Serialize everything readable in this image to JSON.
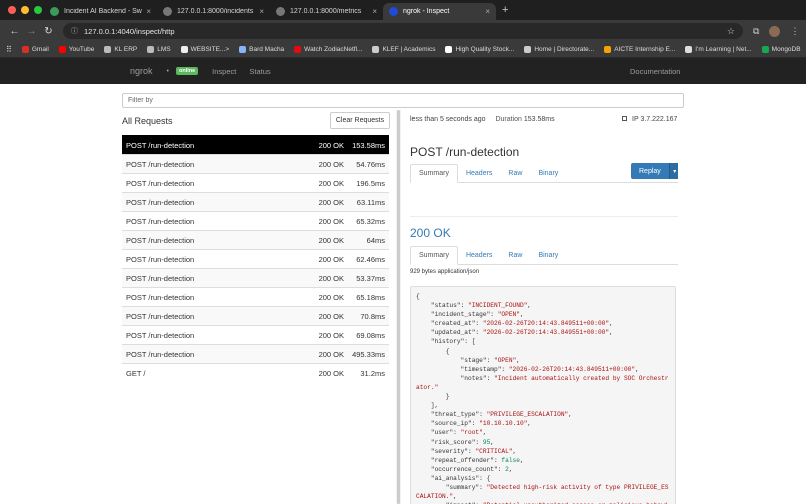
{
  "browser": {
    "tabs": [
      {
        "title": "Incident AI Backend - Swagg",
        "icon_color": "#3c9a5c",
        "active": false
      },
      {
        "title": "127.0.0.1:8000/incidents",
        "icon_color": "#777777",
        "active": false
      },
      {
        "title": "127.0.0.1:8000/metrics",
        "icon_color": "#777777",
        "active": false
      },
      {
        "title": "ngrok - Inspect",
        "icon_color": "#1f4bd8",
        "active": true
      }
    ],
    "url": "127.0.0.1:4040/inspect/http",
    "bookmarks": [
      {
        "label": "Gmail",
        "color": "#d93025"
      },
      {
        "label": "YouTube",
        "color": "#ff0000"
      },
      {
        "label": "KL ERP",
        "color": "#bbbbbb"
      },
      {
        "label": "LMS",
        "color": "#bbbbbb"
      },
      {
        "label": "WEBSITE...>",
        "color": "#eeeeee"
      },
      {
        "label": "Bard Macha",
        "color": "#8ab4f8"
      },
      {
        "label": "Watch ZodiacNetfl...",
        "color": "#e50914"
      },
      {
        "label": "KLEF | Academics",
        "color": "#cccccc"
      },
      {
        "label": "High Quality Stock...",
        "color": "#ffffff"
      },
      {
        "label": "Home | Directorate...",
        "color": "#cccccc"
      },
      {
        "label": "AICTE Internship E...",
        "color": "#f4a300"
      },
      {
        "label": "I'm Learning | Net...",
        "color": "#dddddd"
      },
      {
        "label": "MongoDB",
        "color": "#13aa52"
      }
    ]
  },
  "ngrok": {
    "brand": "ngrok",
    "badge": "online",
    "nav_inspect": "Inspect",
    "nav_status": "Status",
    "documentation": "Documentation"
  },
  "filter": {
    "placeholder": "Filter by"
  },
  "requests": {
    "title": "All Requests",
    "clear_label": "Clear Requests",
    "rows": [
      {
        "path": "POST /run-detection",
        "status": "200 OK",
        "duration": "153.58ms"
      },
      {
        "path": "POST /run-detection",
        "status": "200 OK",
        "duration": "54.76ms"
      },
      {
        "path": "POST /run-detection",
        "status": "200 OK",
        "duration": "196.5ms"
      },
      {
        "path": "POST /run-detection",
        "status": "200 OK",
        "duration": "63.11ms"
      },
      {
        "path": "POST /run-detection",
        "status": "200 OK",
        "duration": "65.32ms"
      },
      {
        "path": "POST /run-detection",
        "status": "200 OK",
        "duration": "64ms"
      },
      {
        "path": "POST /run-detection",
        "status": "200 OK",
        "duration": "62.46ms"
      },
      {
        "path": "POST /run-detection",
        "status": "200 OK",
        "duration": "53.37ms"
      },
      {
        "path": "POST /run-detection",
        "status": "200 OK",
        "duration": "65.18ms"
      },
      {
        "path": "POST /run-detection",
        "status": "200 OK",
        "duration": "70.8ms"
      },
      {
        "path": "POST /run-detection",
        "status": "200 OK",
        "duration": "69.08ms"
      },
      {
        "path": "POST /run-detection",
        "status": "200 OK",
        "duration": "495.33ms"
      },
      {
        "path": "GET /",
        "status": "200 OK",
        "duration": "31.2ms"
      }
    ]
  },
  "detail": {
    "time": "less than 5 seconds ago",
    "duration_label": "Duration",
    "duration": "153.58ms",
    "ip_label": "IP",
    "ip": "3.7.222.167",
    "title": "POST /run-detection",
    "req_tabs": [
      "Summary",
      "Headers",
      "Raw",
      "Binary"
    ],
    "replay": "Replay",
    "status": "200 OK",
    "resp_tabs": [
      "Summary",
      "Headers",
      "Raw",
      "Binary"
    ],
    "size": "929 bytes application/json",
    "body_lines": [
      [
        [
          "p",
          "{"
        ]
      ],
      [
        [
          "p",
          "    \""
        ],
        [
          "k",
          "status"
        ],
        [
          "p",
          "\": "
        ],
        [
          "s",
          "\"INCIDENT_FOUND\""
        ],
        [
          "p",
          ","
        ]
      ],
      [
        [
          "p",
          "    \""
        ],
        [
          "k",
          "incident_stage"
        ],
        [
          "p",
          "\": "
        ],
        [
          "s",
          "\"OPEN\""
        ],
        [
          "p",
          ","
        ]
      ],
      [
        [
          "p",
          "    \""
        ],
        [
          "k",
          "created_at"
        ],
        [
          "p",
          "\": "
        ],
        [
          "s",
          "\"2026-02-26T20:14:43.849511+00:00\""
        ],
        [
          "p",
          ","
        ]
      ],
      [
        [
          "p",
          "    \""
        ],
        [
          "k",
          "updated_at"
        ],
        [
          "p",
          "\": "
        ],
        [
          "s",
          "\"2026-02-26T20:14:43.849551+00:00\""
        ],
        [
          "p",
          ","
        ]
      ],
      [
        [
          "p",
          "    \""
        ],
        [
          "k",
          "history"
        ],
        [
          "p",
          "\": ["
        ]
      ],
      [
        [
          "p",
          "        {"
        ]
      ],
      [
        [
          "p",
          "            \""
        ],
        [
          "k",
          "stage"
        ],
        [
          "p",
          "\": "
        ],
        [
          "s",
          "\"OPEN\""
        ],
        [
          "p",
          ","
        ]
      ],
      [
        [
          "p",
          "            \""
        ],
        [
          "k",
          "timestamp"
        ],
        [
          "p",
          "\": "
        ],
        [
          "s",
          "\"2026-02-26T20:14:43.849511+00:00\""
        ],
        [
          "p",
          ","
        ]
      ],
      [
        [
          "p",
          "            \""
        ],
        [
          "k",
          "notes"
        ],
        [
          "p",
          "\": "
        ],
        [
          "s",
          "\"Incident automatically created by SOC Orchestr"
        ]
      ],
      [
        [
          "s",
          "ator.\""
        ]
      ],
      [
        [
          "p",
          "        }"
        ]
      ],
      [
        [
          "p",
          "    ],"
        ]
      ],
      [
        [
          "p",
          "    \""
        ],
        [
          "k",
          "threat_type"
        ],
        [
          "p",
          "\": "
        ],
        [
          "s",
          "\"PRIVILEGE_ESCALATION\""
        ],
        [
          "p",
          ","
        ]
      ],
      [
        [
          "p",
          "    \""
        ],
        [
          "k",
          "source_ip"
        ],
        [
          "p",
          "\": "
        ],
        [
          "s",
          "\"10.10.10.10\""
        ],
        [
          "p",
          ","
        ]
      ],
      [
        [
          "p",
          "    \""
        ],
        [
          "k",
          "user"
        ],
        [
          "p",
          "\": "
        ],
        [
          "s",
          "\"root\""
        ],
        [
          "p",
          ","
        ]
      ],
      [
        [
          "p",
          "    \""
        ],
        [
          "k",
          "risk_score"
        ],
        [
          "p",
          "\": "
        ],
        [
          "n",
          "95"
        ],
        [
          "p",
          ","
        ]
      ],
      [
        [
          "p",
          "    \""
        ],
        [
          "k",
          "severity"
        ],
        [
          "p",
          "\": "
        ],
        [
          "s",
          "\"CRITICAL\""
        ],
        [
          "p",
          ","
        ]
      ],
      [
        [
          "p",
          "    \""
        ],
        [
          "k",
          "repeat_offender"
        ],
        [
          "p",
          "\": "
        ],
        [
          "b",
          "false"
        ],
        [
          "p",
          ","
        ]
      ],
      [
        [
          "p",
          "    \""
        ],
        [
          "k",
          "occurrence_count"
        ],
        [
          "p",
          "\": "
        ],
        [
          "n",
          "2"
        ],
        [
          "p",
          ","
        ]
      ],
      [
        [
          "p",
          "    \""
        ],
        [
          "k",
          "ai_analysis"
        ],
        [
          "p",
          "\": {"
        ]
      ],
      [
        [
          "p",
          "        \""
        ],
        [
          "k",
          "summary"
        ],
        [
          "p",
          "\": "
        ],
        [
          "s",
          "\"Detected high-risk activity of type PRIVILEGE_ES"
        ]
      ],
      [
        [
          "s",
          "CALATION.\""
        ],
        [
          "p",
          ","
        ]
      ],
      [
        [
          "p",
          "        \""
        ],
        [
          "k",
          "impact"
        ],
        [
          "p",
          "\": "
        ],
        [
          "s",
          "\"Potential unauthorized access or malicious behavi"
        ]
      ]
    ]
  }
}
